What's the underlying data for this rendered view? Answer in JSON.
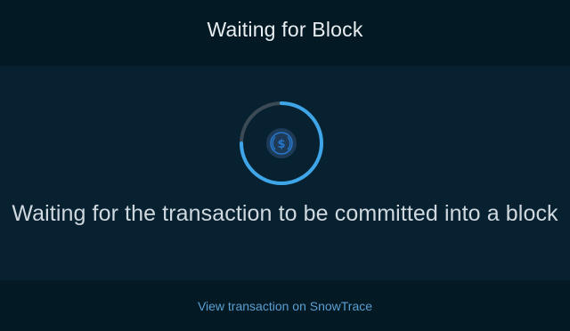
{
  "header": {
    "title": "Waiting for Block"
  },
  "main": {
    "status_text": "Waiting for the transaction to be committed into a block",
    "spinner_icon": "usdc-coin-icon"
  },
  "footer": {
    "link_label": "View transaction on SnowTrace"
  },
  "colors": {
    "background": "#031923",
    "panel": "#072131",
    "spinner_active": "#3ea6e8",
    "spinner_track": "#3b4a55",
    "coin": "#2775ca",
    "link": "#5b9fd3"
  }
}
